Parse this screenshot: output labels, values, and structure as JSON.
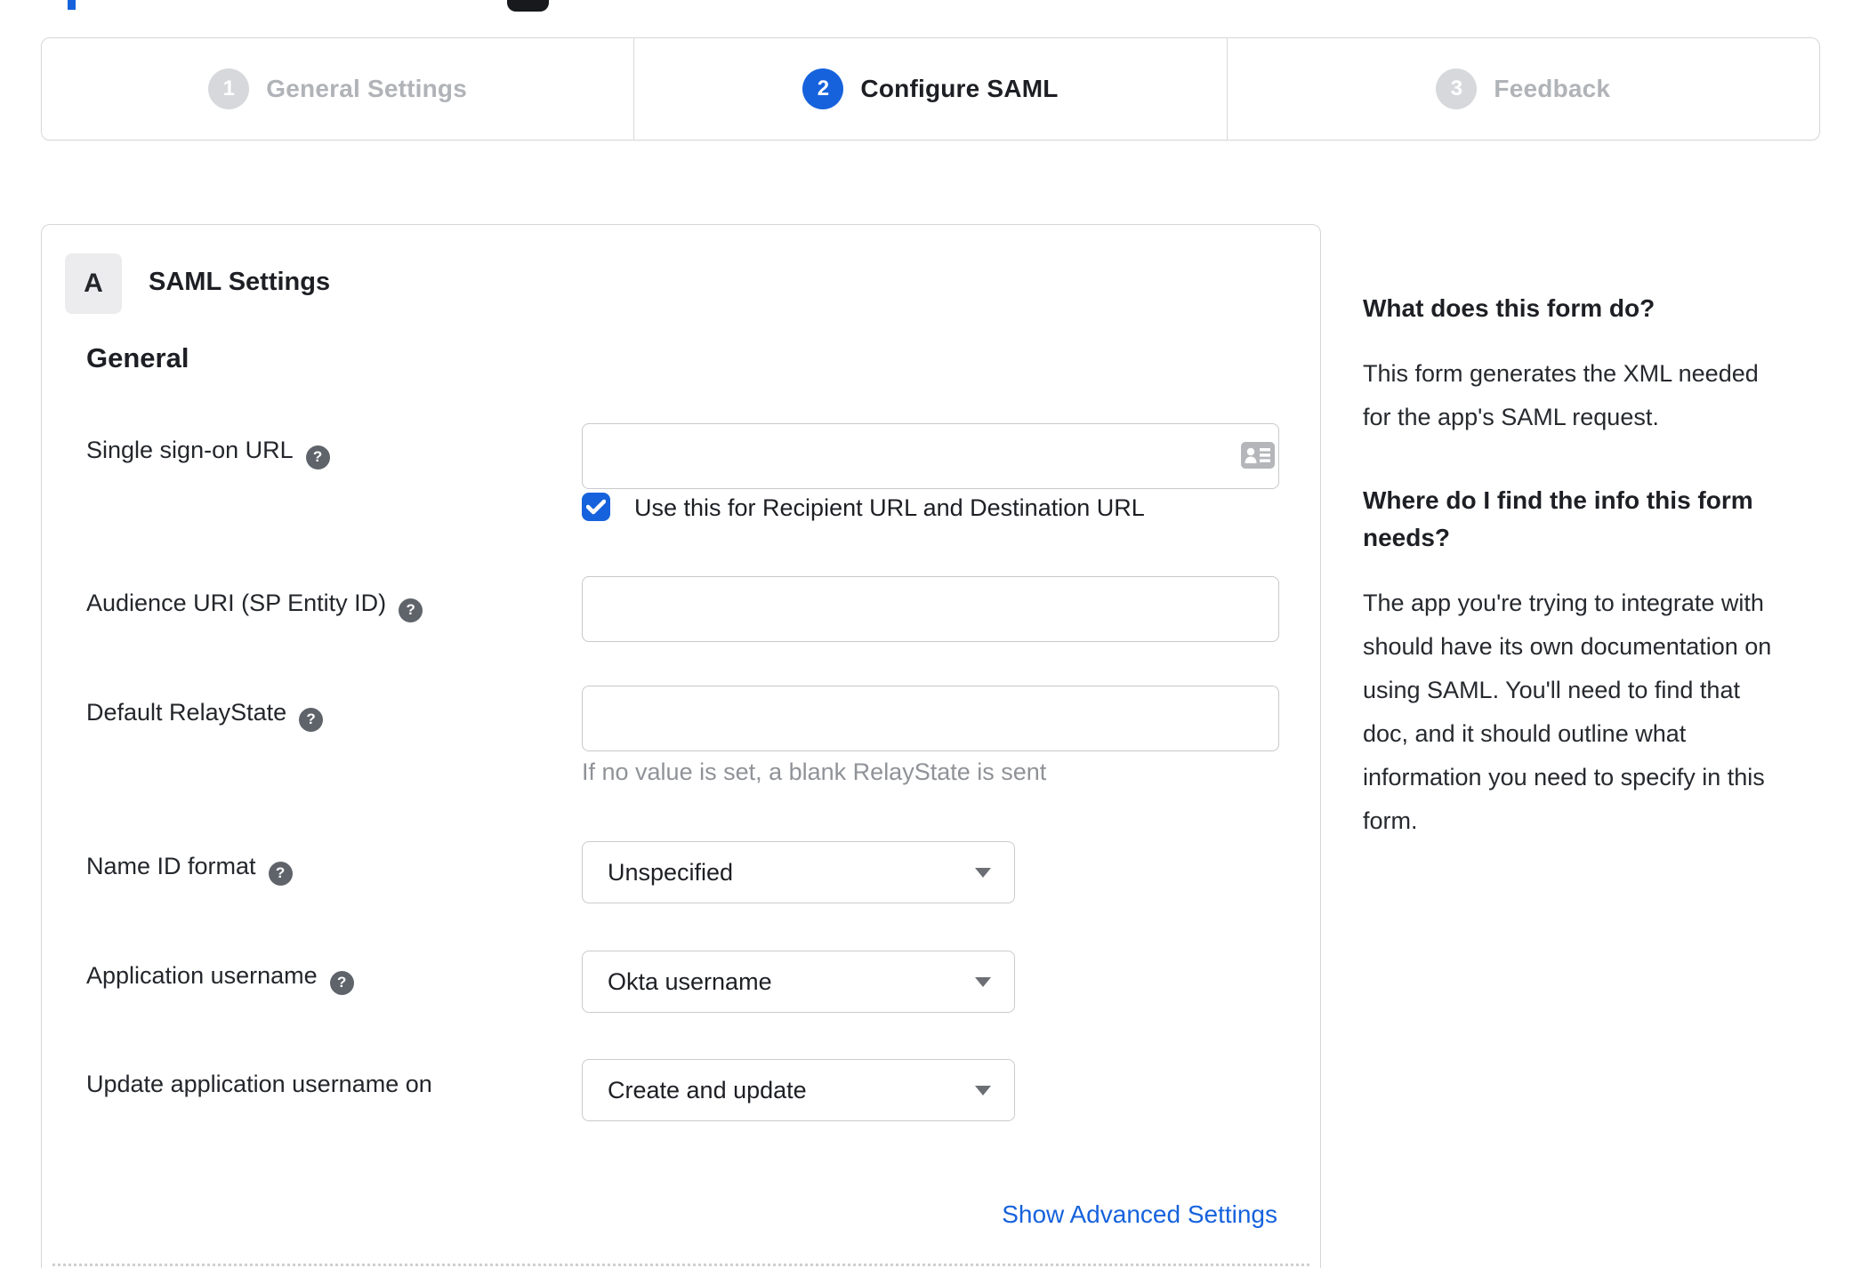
{
  "colors": {
    "accent_blue": "#1662dd",
    "inactive_gray": "#b0b3b7",
    "step_circle_gray": "#d6d8db",
    "border_gray": "#d6d6d6",
    "hint_gray": "#8f9297",
    "help_icon_gray": "#5f646a"
  },
  "stepper": {
    "steps": [
      {
        "number": "1",
        "label": "General Settings",
        "state": "inactive"
      },
      {
        "number": "2",
        "label": "Configure SAML",
        "state": "active"
      },
      {
        "number": "3",
        "label": "Feedback",
        "state": "inactive"
      }
    ]
  },
  "panel": {
    "badge": "A",
    "title": "SAML Settings",
    "section_heading": "General",
    "fields": {
      "sso": {
        "label": "Single sign-on URL",
        "value": "",
        "checkbox_label": "Use this for Recipient URL and Destination URL",
        "checkbox_checked": true
      },
      "audience": {
        "label": "Audience URI (SP Entity ID)",
        "value": ""
      },
      "relay": {
        "label": "Default RelayState",
        "value": "",
        "hint": "If no value is set, a blank RelayState is sent"
      },
      "nameid": {
        "label": "Name ID format",
        "value": "Unspecified"
      },
      "appuser": {
        "label": "Application username",
        "value": "Okta username"
      },
      "update": {
        "label": "Update application username on",
        "value": "Create and update"
      }
    },
    "advanced_link": "Show Advanced Settings"
  },
  "icons": {
    "help": "?"
  },
  "sidebar": {
    "heading1": "What does this form do?",
    "para1": "This form generates the XML needed\nfor the app's SAML request.",
    "heading2": "Where do I find the info this form\nneeds?",
    "para2": "The app you're trying to integrate with\nshould have its own documentation on\nusing SAML. You'll need to find that\ndoc, and it should outline what\ninformation you need to specify in this\nform."
  }
}
